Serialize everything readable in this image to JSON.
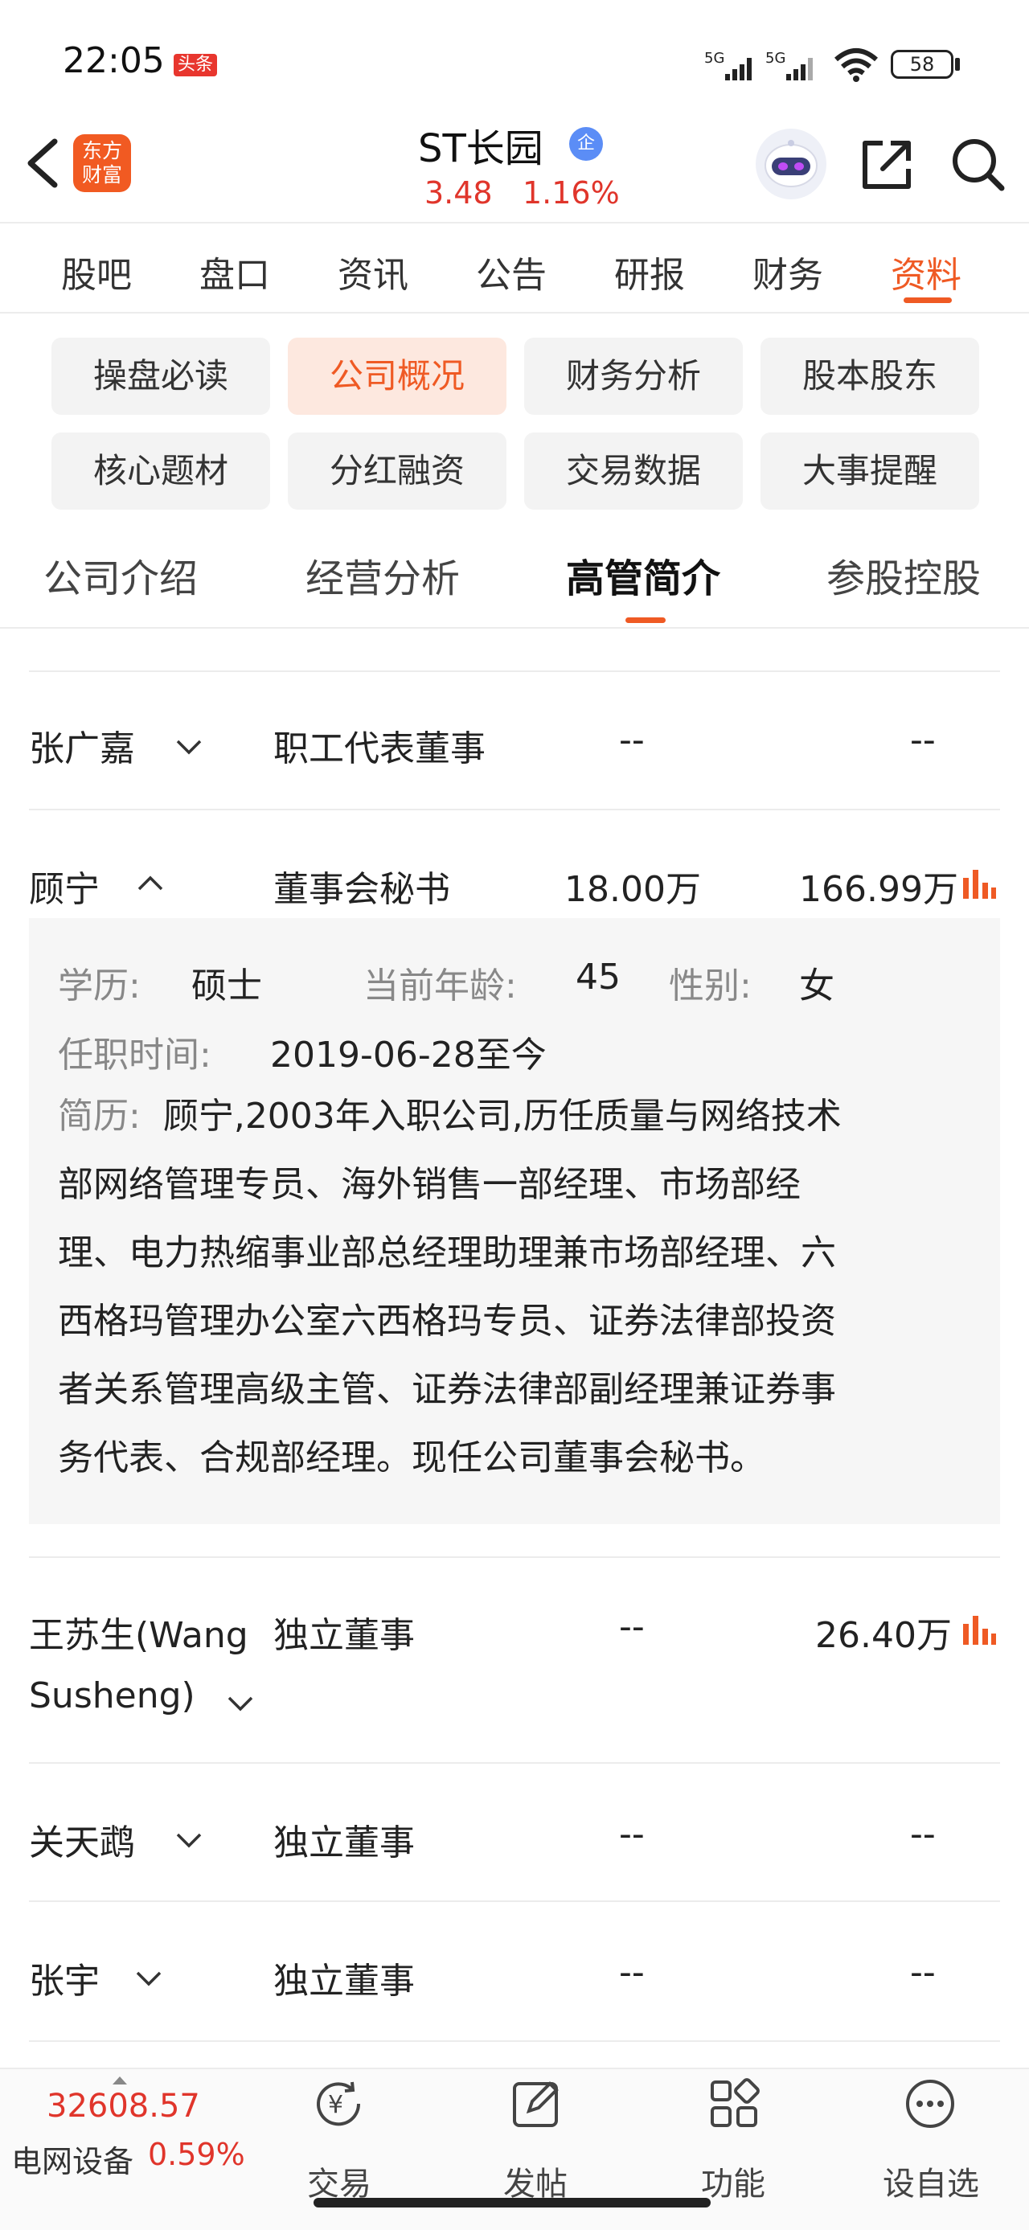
{
  "status_bar": {
    "time": "22:05",
    "news_badge": "头条",
    "net1": "5G",
    "net2": "5G",
    "battery": "58"
  },
  "header": {
    "logo_line1": "东方",
    "logo_line2": "财富",
    "title": "ST长园",
    "badge": "企",
    "price": "3.48",
    "change_pct": "1.16%"
  },
  "main_tabs": [
    {
      "label": "股吧"
    },
    {
      "label": "盘口"
    },
    {
      "label": "资讯"
    },
    {
      "label": "公告"
    },
    {
      "label": "研报"
    },
    {
      "label": "财务"
    },
    {
      "label": "资料"
    }
  ],
  "sub_tabs": [
    {
      "label": "操盘必读"
    },
    {
      "label": "公司概况"
    },
    {
      "label": "财务分析"
    },
    {
      "label": "股本股东"
    },
    {
      "label": "核心题材"
    },
    {
      "label": "分红融资"
    },
    {
      "label": "交易数据"
    },
    {
      "label": "大事提醒"
    }
  ],
  "third_tabs": [
    {
      "label": "公司介绍"
    },
    {
      "label": "经营分析"
    },
    {
      "label": "高管简介"
    },
    {
      "label": "参股控股"
    }
  ],
  "rows": [
    {
      "name": "张广嘉",
      "title": "职工代表董事",
      "shares": "--",
      "salary": "--"
    },
    {
      "name": "顾宁",
      "title": "董事会秘书",
      "shares": "18.00万",
      "salary": "166.99万"
    },
    {
      "name_line1": "王苏生(Wang",
      "name_line2": "Susheng)",
      "title": "独立董事",
      "shares": "--",
      "salary": "26.40万"
    },
    {
      "name": "关天鹉",
      "title": "独立董事",
      "shares": "--",
      "salary": "--"
    },
    {
      "name": "张宇",
      "title": "独立董事",
      "shares": "--",
      "salary": "--"
    }
  ],
  "detail": {
    "edu_label": "学历:",
    "edu": "硕士",
    "age_label": "当前年龄:",
    "age": "45",
    "sex_label": "性别:",
    "sex": "女",
    "term_label": "任职时间:",
    "term": "2019-06-28至今",
    "resume_label": "简历:",
    "resume_lines": [
      "顾宁,2003年入职公司,历任质量与网络技术",
      "部网络管理专员、海外销售一部经理、市场部经",
      "理、电力热缩事业部总经理助理兼市场部经理、六",
      "西格玛管理办公室六西格玛专员、证券法律部投资",
      "者关系管理高级主管、证券法律部副经理兼证券事",
      "务代表、合规部经理。现任公司董事会秘书。"
    ]
  },
  "bottom_bar": {
    "index_value": "32608.57",
    "index_name": "电网设备",
    "index_pct": "0.59%",
    "nav": [
      {
        "label": "交易"
      },
      {
        "label": "发帖"
      },
      {
        "label": "功能"
      },
      {
        "label": "设自选"
      }
    ]
  },
  "colors": {
    "accent": "#ef5a24",
    "up": "#e0352b",
    "chip_bg": "#f3f3f3",
    "chip_active_bg": "#fde8df"
  }
}
